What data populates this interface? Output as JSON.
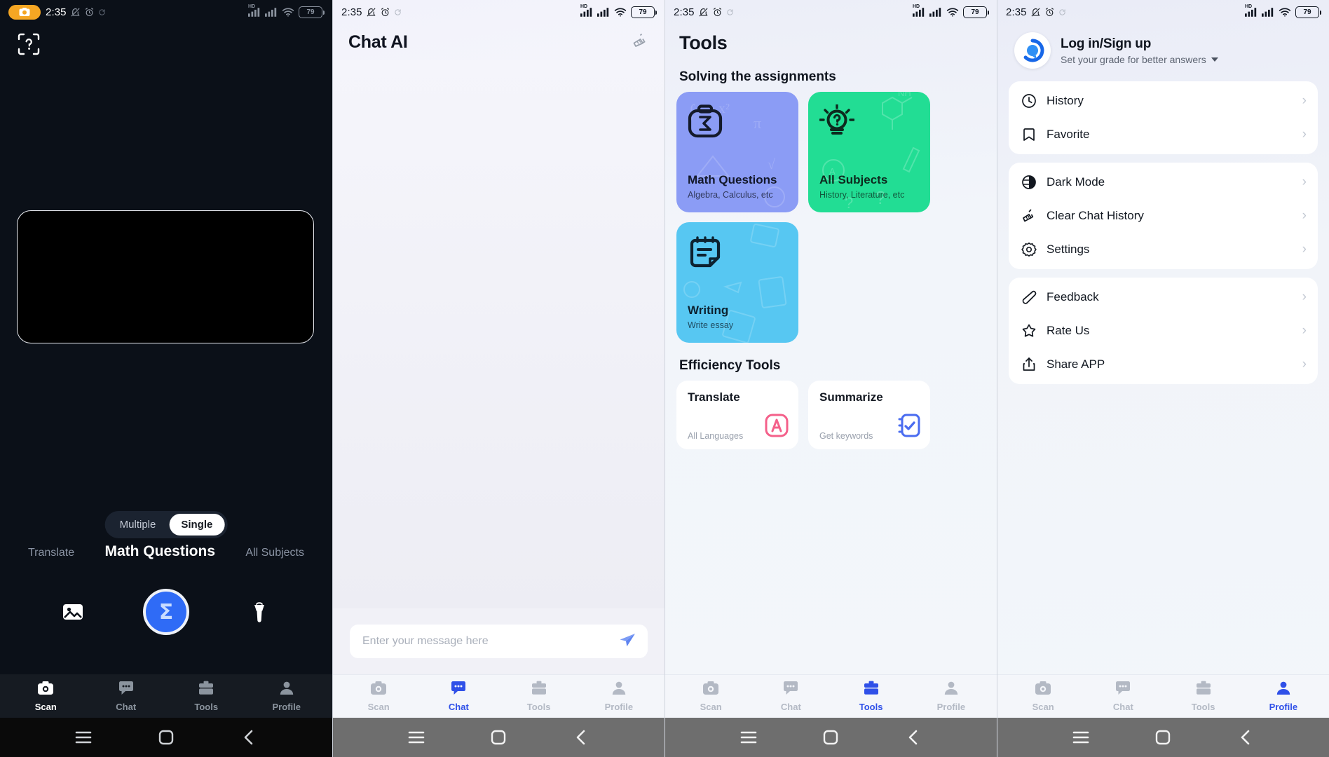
{
  "status_bar": {
    "time": "2:35",
    "battery_level": "79",
    "icons": [
      "mute-icon",
      "alarm-icon",
      "sync-icon",
      "hd-signal-icon",
      "signal-icon",
      "wifi-icon",
      "battery-icon"
    ],
    "camera_badge": "camera-icon"
  },
  "android_nav": {
    "menu": "menu-icon",
    "home": "home-icon",
    "back": "back-icon"
  },
  "tabs": [
    {
      "label": "Scan",
      "icon": "camera-icon"
    },
    {
      "label": "Chat",
      "icon": "chat-bubble-icon"
    },
    {
      "label": "Tools",
      "icon": "toolbox-icon"
    },
    {
      "label": "Profile",
      "icon": "person-icon"
    }
  ],
  "colors": {
    "accent_blue": "#2f50e8",
    "shutter_blue": "#2f6bf6",
    "math_card": "#8b9cf5",
    "subjects_card": "#22dd94",
    "writing_card": "#57c7f2",
    "translate_icon": "#f4608a",
    "summarize_icon": "#4a6cf0",
    "camera_pill": "#f5a623",
    "dark_bg": "#0b1018"
  },
  "scan_screen": {
    "help_icon": "scan-help-icon",
    "capture_mode": {
      "options": [
        "Multiple",
        "Single"
      ],
      "selected": "Single"
    },
    "modes": [
      "Translate",
      "Math Questions",
      "All Subjects"
    ],
    "active_mode": "Math Questions",
    "gallery_icon": "gallery-icon",
    "shutter_glyph": "Σ",
    "flash_icon": "flashlight-icon",
    "active_tab": "Scan"
  },
  "chat_screen": {
    "title": "Chat AI",
    "clear_icon": "broom-icon",
    "input_placeholder": "Enter your message here",
    "input_value": "",
    "send_icon": "send-icon",
    "active_tab": "Chat"
  },
  "tools_screen": {
    "title": "Tools",
    "sections": [
      {
        "heading": "Solving the assignments",
        "cards": [
          {
            "title": "Math Questions",
            "subtitle": "Algebra, Calculus, etc",
            "icon": "camera-sigma-icon",
            "color": "#8b9cf5"
          },
          {
            "title": "All Subjects",
            "subtitle": "History, Literature, etc",
            "icon": "lightbulb-question-icon",
            "color": "#22dd94"
          },
          {
            "title": "Writing",
            "subtitle": "Write essay",
            "icon": "notepad-icon",
            "color": "#57c7f2"
          }
        ]
      },
      {
        "heading": "Efficiency Tools",
        "cards": [
          {
            "title": "Translate",
            "subtitle": "All Languages",
            "icon": "letter-a-icon",
            "color": "#f4608a"
          },
          {
            "title": "Summarize",
            "subtitle": "Get keywords",
            "icon": "checklist-icon",
            "color": "#4a6cf0"
          }
        ]
      }
    ],
    "active_tab": "Tools"
  },
  "profile_screen": {
    "account": {
      "name": "Log in/Sign up",
      "subtitle": "Set your grade for better answers",
      "avatar_icon": "app-logo-icon",
      "dropdown_icon": "chevron-down-icon"
    },
    "menu_groups": [
      [
        {
          "label": "History",
          "icon": "clock-icon"
        },
        {
          "label": "Favorite",
          "icon": "bookmark-icon"
        }
      ],
      [
        {
          "label": "Dark Mode",
          "icon": "contrast-icon"
        },
        {
          "label": "Clear Chat History",
          "icon": "broom-icon"
        },
        {
          "label": "Settings",
          "icon": "gear-icon"
        }
      ],
      [
        {
          "label": "Feedback",
          "icon": "pencil-icon"
        },
        {
          "label": "Rate Us",
          "icon": "star-icon"
        },
        {
          "label": "Share APP",
          "icon": "share-icon"
        }
      ]
    ],
    "chevron": "›",
    "active_tab": "Profile"
  }
}
